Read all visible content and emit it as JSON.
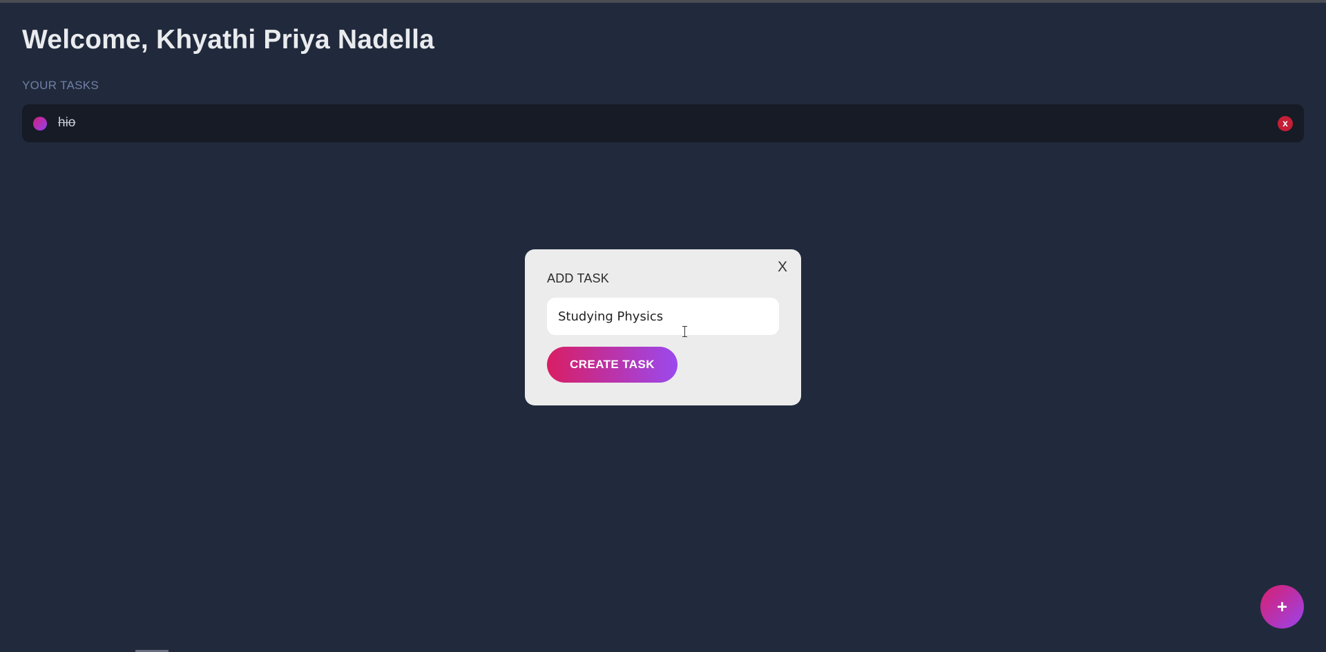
{
  "page": {
    "welcome": "Welcome, Khyathi Priya Nadella",
    "section_label": "YOUR TASKS"
  },
  "tasks": [
    {
      "text": "hio",
      "completed": true,
      "delete_label": "x"
    }
  ],
  "modal": {
    "title": "ADD TASK",
    "close_label": "X",
    "input_value": "Studying Physics",
    "create_label": "CREATE TASK"
  },
  "fab": {
    "label": "+",
    "icon": "plus-icon"
  },
  "colors": {
    "background": "#212a3c",
    "task_row": "#161b26",
    "accent_start": "#d91e64",
    "accent_end": "#9b49ef",
    "delete_red": "#c41f35"
  }
}
